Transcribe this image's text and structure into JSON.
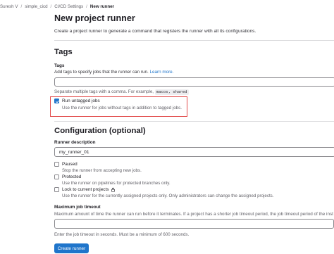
{
  "breadcrumb": {
    "items": [
      "Suresh V",
      "simple_cicd",
      "CI/CD Settings",
      "New runner"
    ]
  },
  "page": {
    "title": "New project runner",
    "description": "Create a project runner to generate a command that registers the runner with all its configurations."
  },
  "tags_section": {
    "heading": "Tags",
    "tags_label": "Tags",
    "tags_help": "Add tags to specify jobs that the runner can run.",
    "learn_more": "Learn more.",
    "tags_value": "",
    "tags_hint_prefix": "Separate multiple tags with a comma. For example,",
    "tags_hint_code": "macos, shared",
    "run_untagged": {
      "label": "Run untagged jobs",
      "hint": "Use the runner for jobs without tags in addition to tagged jobs.",
      "checked": true
    }
  },
  "config_section": {
    "heading": "Configuration (optional)",
    "description_label": "Runner description",
    "description_value": "my_runner_01",
    "paused": {
      "label": "Paused",
      "hint": "Stop the runner from accepting new jobs.",
      "checked": false
    },
    "protected": {
      "label": "Protected",
      "hint": "Use the runner on pipelines for protected branches only.",
      "checked": false
    },
    "locked": {
      "label": "Lock to current projects",
      "hint": "Use the runner for the currently assigned projects only. Only administrators can change the assigned projects.",
      "checked": false,
      "icon": "lock-icon"
    },
    "timeout_label": "Maximum job timeout",
    "timeout_help": "Maximum amount of time the runner can run before it terminates. If a project has a shorter job timeout period, the job timeout period of the inst",
    "timeout_value": "",
    "timeout_hint": "Enter the job timeout in seconds. Must be a minimum of 600 seconds."
  },
  "submit_label": "Create runner",
  "colors": {
    "primary": "#1f75cb",
    "highlight_border": "#e24b4b"
  }
}
